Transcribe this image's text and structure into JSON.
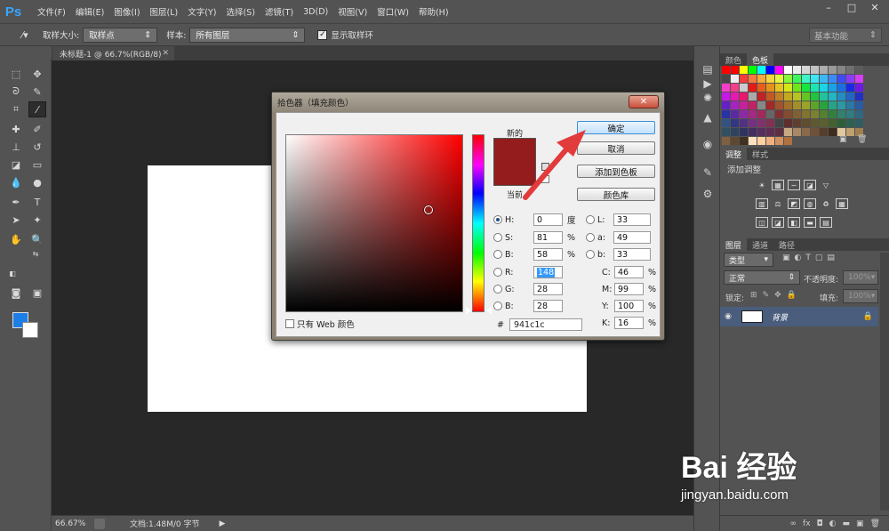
{
  "app": {
    "logo": "Ps",
    "menu": [
      "文件(F)",
      "编辑(E)",
      "图像(I)",
      "图层(L)",
      "文字(Y)",
      "选择(S)",
      "滤镜(T)",
      "3D(D)",
      "视图(V)",
      "窗口(W)",
      "帮助(H)"
    ],
    "window_buttons": [
      "–",
      "□",
      "✕"
    ]
  },
  "options_bar": {
    "sample_size_label": "取样大小:",
    "sample_size_value": "取样点",
    "sample_label": "样本:",
    "sample_value": "所有图层",
    "show_ring_label": "显示取样环",
    "show_ring_checked": true,
    "workspace": "基本功能"
  },
  "document": {
    "tab_title": "未标题-1 @ 66.7%(RGB/8)",
    "zoom": "66.67%",
    "doc_info": "文档:1.48M/0 字节"
  },
  "tools": {
    "foreground_color": "#1e7ee8",
    "background_color": "#ffffff"
  },
  "panels": {
    "swatches_tabs": [
      "颜色",
      "色板"
    ],
    "adjust_tabs": [
      "调整",
      "样式"
    ],
    "add_adjustment": "添加调整",
    "layers_tabs": [
      "图层",
      "通道",
      "路径"
    ],
    "kind_filter": "类型",
    "blend_mode": "正常",
    "opacity_label": "不透明度:",
    "opacity_value": "100%",
    "lock_label": "锁定:",
    "fill_label": "填充:",
    "fill_value": "100%",
    "layer_name": "背景"
  },
  "color_picker": {
    "title": "拾色器（填充颜色）",
    "new_label": "新的",
    "current_label": "当前",
    "new_color": "#941c1c",
    "buttons": {
      "ok": "确定",
      "cancel": "取消",
      "add_to_swatches": "添加到色板",
      "color_libraries": "颜色库"
    },
    "web_only_label": "只有 Web 颜色",
    "hsb": {
      "h_label": "H:",
      "h_value": "0",
      "h_unit": "度",
      "s_label": "S:",
      "s_value": "81",
      "s_unit": "%",
      "b_label": "B:",
      "b_value": "58",
      "b_unit": "%"
    },
    "rgb": {
      "r_label": "R:",
      "r_value": "148",
      "g_label": "G:",
      "g_value": "28",
      "b_label": "B:",
      "b_value": "28"
    },
    "lab": {
      "l_label": "L:",
      "l_value": "33",
      "a_label": "a:",
      "a_value": "49",
      "b_label": "b:",
      "b_value": "33"
    },
    "cmyk": {
      "c_label": "C:",
      "c_value": "46",
      "c_unit": "%",
      "m_label": "M:",
      "m_value": "99",
      "m_unit": "%",
      "y_label": "Y:",
      "y_value": "100",
      "y_unit": "%",
      "k_label": "K:",
      "k_value": "16",
      "k_unit": "%"
    },
    "hex_label": "#",
    "hex_value": "941c1c"
  },
  "watermark": {
    "brand": "Bai 经验",
    "url": "jingyan.baidu.com"
  }
}
